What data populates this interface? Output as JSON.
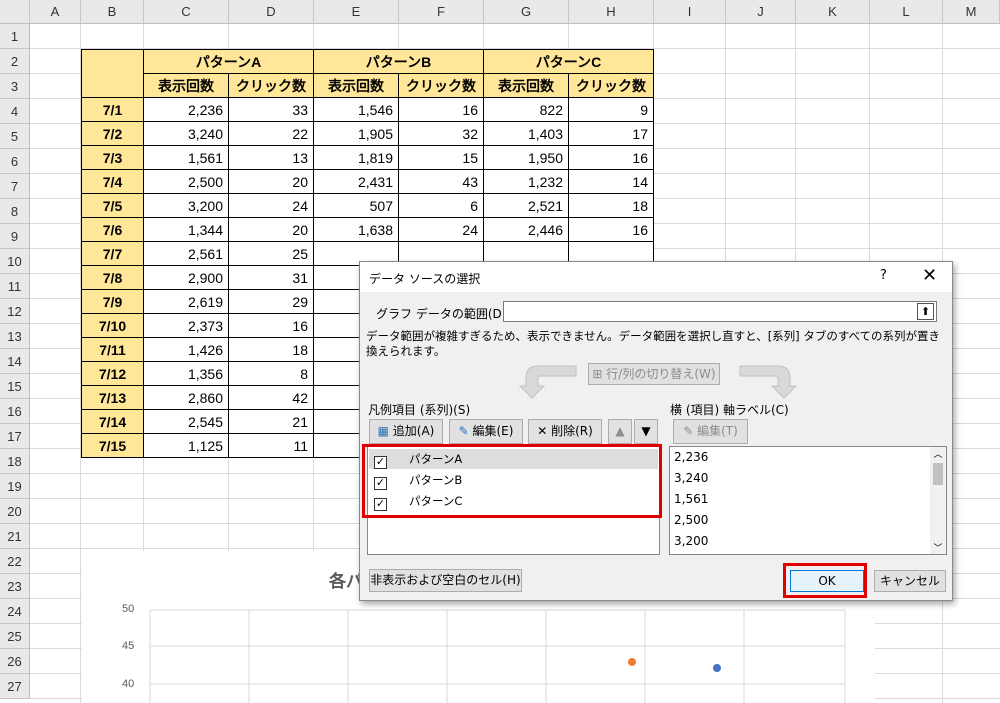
{
  "columns": [
    "A",
    "B",
    "C",
    "D",
    "E",
    "F",
    "G",
    "H",
    "I",
    "J",
    "K",
    "L",
    "M"
  ],
  "rows": [
    "1",
    "2",
    "3",
    "4",
    "5",
    "6",
    "7",
    "8",
    "9",
    "10",
    "11",
    "12",
    "13",
    "14",
    "15",
    "16",
    "17",
    "18",
    "19",
    "20",
    "21",
    "22",
    "23",
    "24",
    "25",
    "26",
    "27"
  ],
  "table": {
    "group_headers": [
      "パターンA",
      "パターンB",
      "パターンC"
    ],
    "sub_headers": [
      "表示回数",
      "クリック数",
      "表示回数",
      "クリック数",
      "表示回数",
      "クリック数"
    ],
    "rows": [
      {
        "date": "7/1",
        "v": [
          "2,236",
          "33",
          "1,546",
          "16",
          "822",
          "9"
        ]
      },
      {
        "date": "7/2",
        "v": [
          "3,240",
          "22",
          "1,905",
          "32",
          "1,403",
          "17"
        ]
      },
      {
        "date": "7/3",
        "v": [
          "1,561",
          "13",
          "1,819",
          "15",
          "1,950",
          "16"
        ]
      },
      {
        "date": "7/4",
        "v": [
          "2,500",
          "20",
          "2,431",
          "43",
          "1,232",
          "14"
        ]
      },
      {
        "date": "7/5",
        "v": [
          "3,200",
          "24",
          "507",
          "6",
          "2,521",
          "18"
        ]
      },
      {
        "date": "7/6",
        "v": [
          "1,344",
          "20",
          "1,638",
          "24",
          "2,446",
          "16"
        ]
      },
      {
        "date": "7/7",
        "v": [
          "2,561",
          "25",
          "",
          "",
          "",
          ""
        ]
      },
      {
        "date": "7/8",
        "v": [
          "2,900",
          "31",
          "",
          "",
          "",
          ""
        ]
      },
      {
        "date": "7/9",
        "v": [
          "2,619",
          "29",
          "",
          "",
          "",
          ""
        ]
      },
      {
        "date": "7/10",
        "v": [
          "2,373",
          "16",
          "",
          "",
          "",
          ""
        ]
      },
      {
        "date": "7/11",
        "v": [
          "1,426",
          "18",
          "",
          "",
          "",
          ""
        ]
      },
      {
        "date": "7/12",
        "v": [
          "1,356",
          "8",
          "",
          "",
          "",
          ""
        ]
      },
      {
        "date": "7/13",
        "v": [
          "2,860",
          "42",
          "",
          "",
          "",
          ""
        ]
      },
      {
        "date": "7/14",
        "v": [
          "2,545",
          "21",
          "",
          "",
          "",
          ""
        ]
      },
      {
        "date": "7/15",
        "v": [
          "1,125",
          "11",
          "",
          "",
          "",
          ""
        ]
      }
    ]
  },
  "chart": {
    "title": "各パ",
    "y_ticks": [
      "50",
      "45",
      "40"
    ],
    "points": [
      {
        "series": "orange",
        "x_frac": 0.0,
        "y": 42.8,
        "color": "#ed7d31"
      },
      {
        "series": "blue",
        "x_frac": 0.0,
        "y": 42.2,
        "color": "#4472c4"
      }
    ]
  },
  "dialog": {
    "title": "データ ソースの選択",
    "help": "?",
    "close": "✕",
    "range_label": "グラフ データの範囲(D):",
    "range_value": "",
    "message": "データ範囲が複雑すぎるため、表示できません。データ範囲を選択し直すと、[系列] タブのすべての系列が置き換えられます。",
    "switch_button": "行/列の切り替え(W)",
    "legend_label": "凡例項目 (系列)(S)",
    "add_button": "追加(A)",
    "edit_button": "編集(E)",
    "delete_button": "削除(R)",
    "axis_label": "横 (項目) 軸ラベル(C)",
    "axis_edit_button": "編集(T)",
    "series": [
      {
        "name": "パターンA",
        "checked": "☑"
      },
      {
        "name": "パターンB",
        "checked": "☑"
      },
      {
        "name": "パターンC",
        "checked": "☑"
      }
    ],
    "axis_values": [
      "2,236",
      "3,240",
      "1,561",
      "2,500",
      "3,200"
    ],
    "hidden_cells_button": "非表示および空白のセル(H)",
    "ok_button": "OK",
    "cancel_button": "キャンセル",
    "accent_color": "#e00000"
  }
}
